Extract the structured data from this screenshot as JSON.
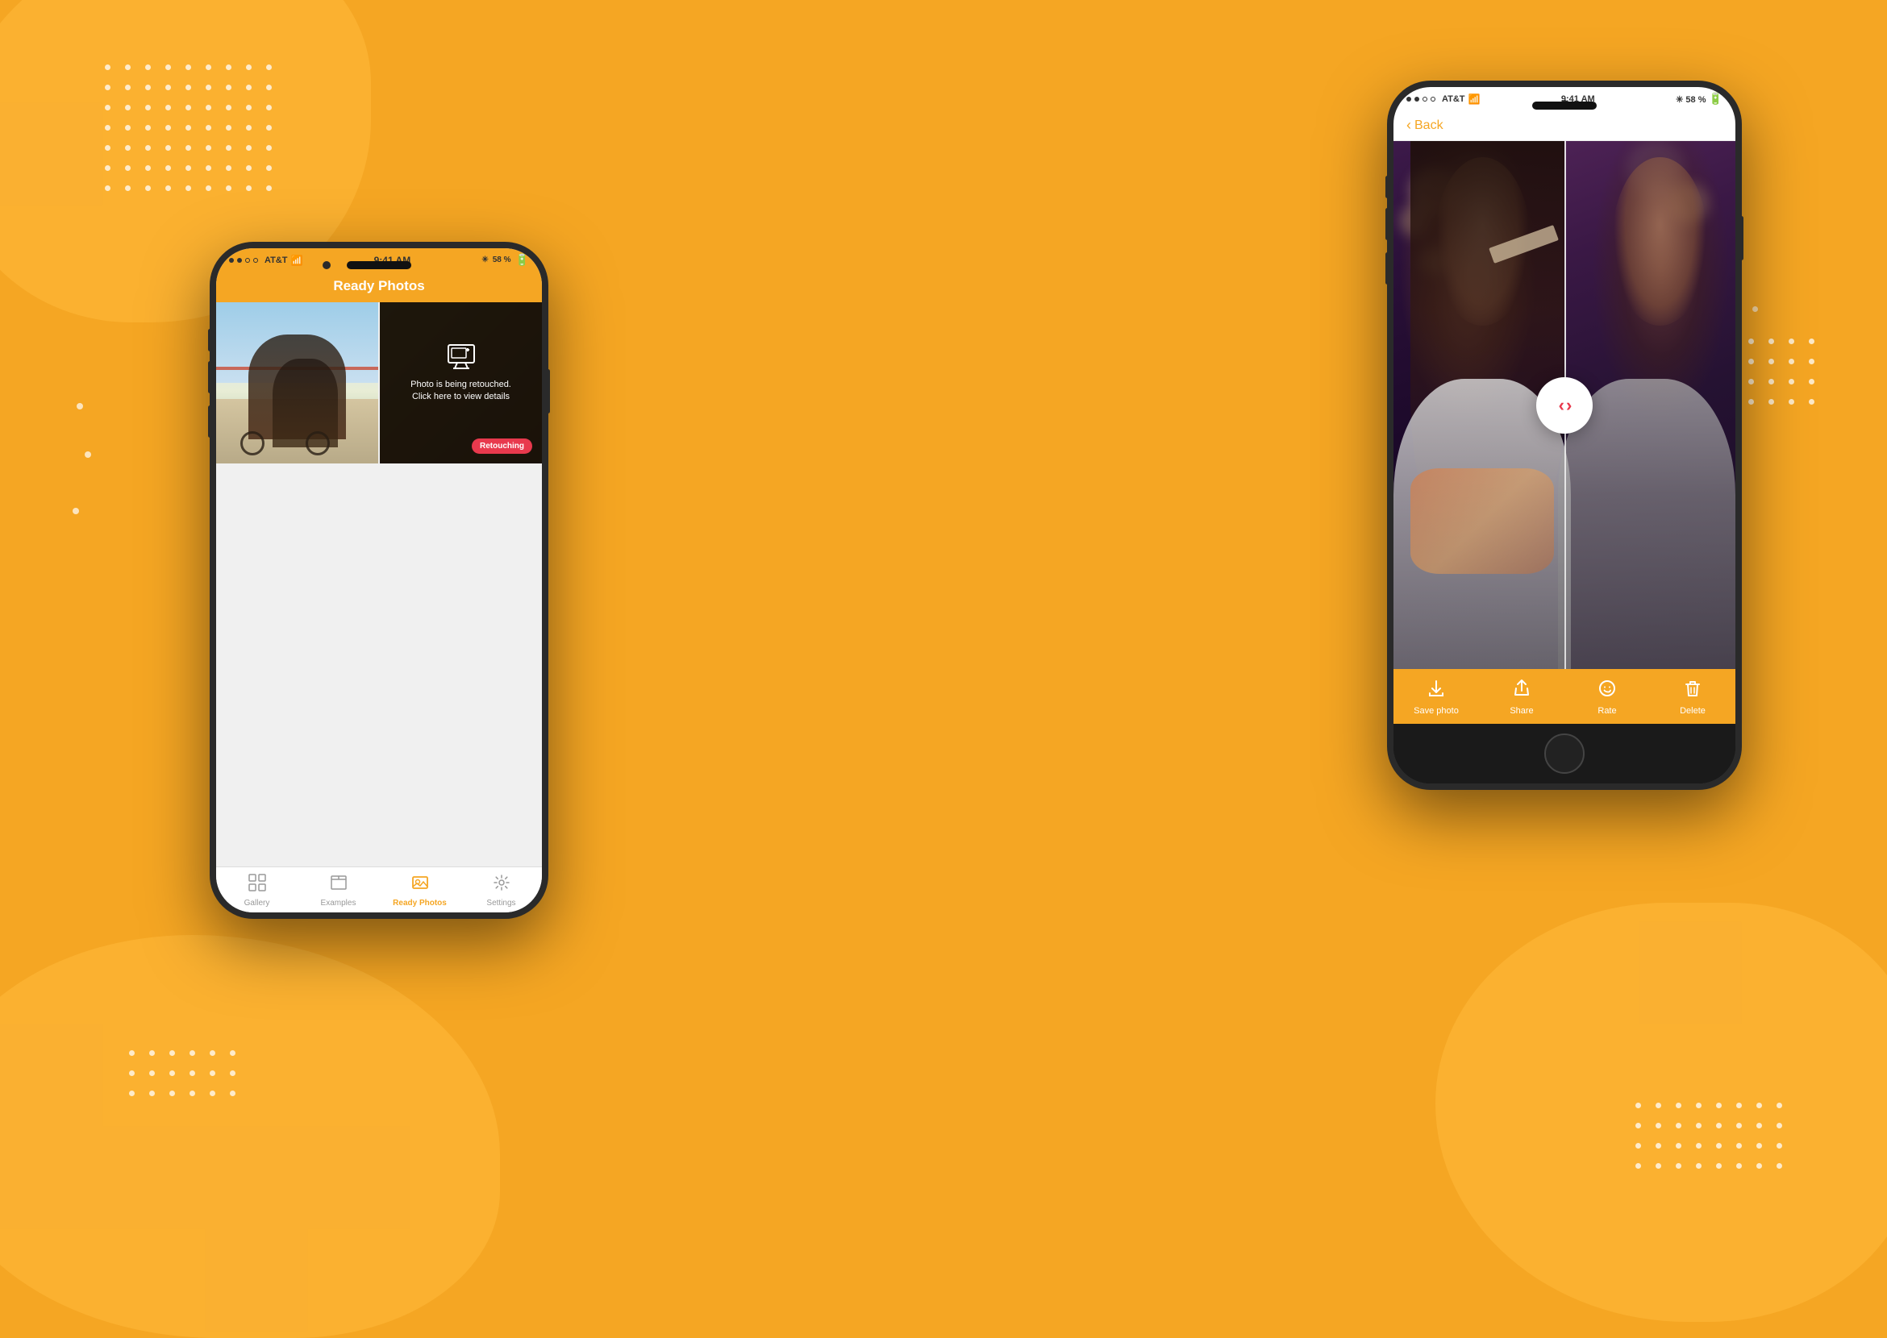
{
  "background": {
    "color": "#F5A623"
  },
  "decorative": {
    "blob_color": "rgba(255,185,60,0.55)",
    "dot_color": "rgba(255,255,255,0.75)"
  },
  "phone_left": {
    "status_bar": {
      "carrier": "AT&T",
      "signal": "●●○○",
      "wifi_icon": "wifi",
      "time": "9:41 AM",
      "battery_icon": "battery",
      "battery_pct": "58 %"
    },
    "header": {
      "title": "Ready Photos"
    },
    "photo_grid": {
      "cell_right_text": "Photo is being retouched. Click here to view details",
      "retouching_label": "Retouching"
    },
    "tab_bar": {
      "items": [
        {
          "id": "gallery",
          "label": "Gallery",
          "icon": "⊞",
          "active": false
        },
        {
          "id": "examples",
          "label": "Examples",
          "icon": "▭",
          "active": false
        },
        {
          "id": "ready",
          "label": "Ready Photos",
          "icon": "🖼",
          "active": true
        },
        {
          "id": "settings",
          "label": "Settings",
          "icon": "⚙",
          "active": false
        }
      ]
    }
  },
  "phone_right": {
    "status_bar": {
      "carrier": "AT&T",
      "signal": "●●○○",
      "wifi_icon": "wifi",
      "time": "9:41 AM",
      "battery_icon": "battery",
      "battery_pct": "58 %"
    },
    "back_button": {
      "label": "Back",
      "chevron": "‹"
    },
    "action_bar": {
      "items": [
        {
          "id": "save",
          "label": "Save photo",
          "icon": "⬇"
        },
        {
          "id": "share",
          "label": "Share",
          "icon": "↑"
        },
        {
          "id": "rate",
          "label": "Rate",
          "icon": "☺"
        },
        {
          "id": "delete",
          "label": "Delete",
          "icon": "🗑"
        }
      ]
    }
  }
}
